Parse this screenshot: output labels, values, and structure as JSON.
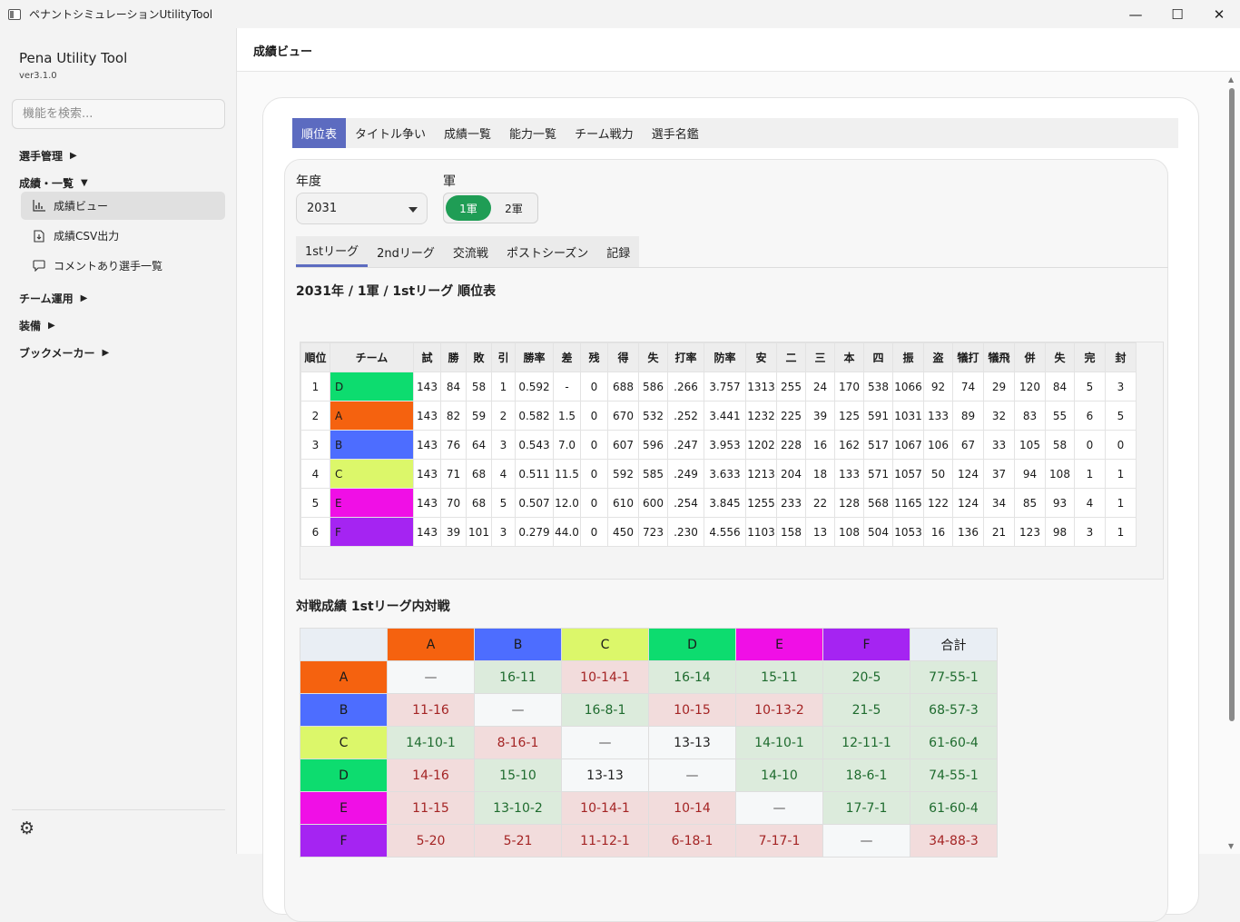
{
  "window": {
    "title": "ペナントシミュレーションUtilityTool",
    "minimize": "—",
    "maximize": "☐",
    "close": "✕"
  },
  "sidebar": {
    "app_name": "Pena Utility Tool",
    "version": "ver3.1.0",
    "search_placeholder": "機能を検索...",
    "groups": [
      {
        "label": "選手管理",
        "arrow": "▶"
      },
      {
        "label": "成績・一覧",
        "arrow": "▼"
      },
      {
        "label": "チーム運用",
        "arrow": "▶"
      },
      {
        "label": "装備",
        "arrow": "▶"
      },
      {
        "label": "ブックメーカー",
        "arrow": "▶"
      }
    ],
    "items": [
      {
        "label": "成績ビュー",
        "icon": "chart-icon"
      },
      {
        "label": "成績CSV出力",
        "icon": "export-icon"
      },
      {
        "label": "コメントあり選手一覧",
        "icon": "comment-icon"
      }
    ]
  },
  "header": {
    "title": "成績ビュー"
  },
  "tabs": [
    "順位表",
    "タイトル争い",
    "成績一覧",
    "能力一覧",
    "チーム戦力",
    "選手名鑑"
  ],
  "filters": {
    "year_label": "年度",
    "year_value": "2031",
    "squad_label": "軍",
    "squad_on": "1軍",
    "squad_off": "2軍"
  },
  "subtabs": [
    "1stリーグ",
    "2ndリーグ",
    "交流戦",
    "ポストシーズン",
    "記録"
  ],
  "standings": {
    "title": "2031年 / 1軍 / 1stリーグ 順位表",
    "headers": [
      "順位",
      "チーム",
      "試",
      "勝",
      "敗",
      "引",
      "勝率",
      "差",
      "残",
      "得",
      "失",
      "打率",
      "防率",
      "安",
      "二",
      "三",
      "本",
      "四",
      "振",
      "盗",
      "犠打",
      "犠飛",
      "併",
      "失",
      "完",
      "封"
    ],
    "rows": [
      [
        "1",
        "D",
        "143",
        "84",
        "58",
        "1",
        "0.592",
        "-",
        "0",
        "688",
        "586",
        ".266",
        "3.757",
        "1313",
        "255",
        "24",
        "170",
        "538",
        "1066",
        "92",
        "74",
        "29",
        "120",
        "84",
        "5",
        "3"
      ],
      [
        "2",
        "A",
        "143",
        "82",
        "59",
        "2",
        "0.582",
        "1.5",
        "0",
        "670",
        "532",
        ".252",
        "3.441",
        "1232",
        "225",
        "39",
        "125",
        "591",
        "1031",
        "133",
        "89",
        "32",
        "83",
        "55",
        "6",
        "5"
      ],
      [
        "3",
        "B",
        "143",
        "76",
        "64",
        "3",
        "0.543",
        "7.0",
        "0",
        "607",
        "596",
        ".247",
        "3.953",
        "1202",
        "228",
        "16",
        "162",
        "517",
        "1067",
        "106",
        "67",
        "33",
        "105",
        "58",
        "0",
        "0"
      ],
      [
        "4",
        "C",
        "143",
        "71",
        "68",
        "4",
        "0.511",
        "11.5",
        "0",
        "592",
        "585",
        ".249",
        "3.633",
        "1213",
        "204",
        "18",
        "133",
        "571",
        "1057",
        "50",
        "124",
        "37",
        "94",
        "108",
        "1",
        "1"
      ],
      [
        "5",
        "E",
        "143",
        "70",
        "68",
        "5",
        "0.507",
        "12.0",
        "0",
        "610",
        "600",
        ".254",
        "3.845",
        "1255",
        "233",
        "22",
        "128",
        "568",
        "1165",
        "122",
        "124",
        "34",
        "85",
        "93",
        "4",
        "1"
      ],
      [
        "6",
        "F",
        "143",
        "39",
        "101",
        "3",
        "0.279",
        "44.0",
        "0",
        "450",
        "723",
        ".230",
        "4.556",
        "1103",
        "158",
        "13",
        "108",
        "504",
        "1053",
        "16",
        "136",
        "21",
        "123",
        "98",
        "3",
        "1"
      ]
    ]
  },
  "team_colors": {
    "A": "#f5620f",
    "B": "#4d6dff",
    "C": "#dcf76a",
    "D": "#0ddc6f",
    "E": "#f00fe6",
    "F": "#a524f2"
  },
  "vs": {
    "title": "対戦成績 1stリーグ内対戦",
    "columns": [
      "A",
      "B",
      "C",
      "D",
      "E",
      "F"
    ],
    "total_label": "合計",
    "rows": [
      {
        "team": "A",
        "cells": [
          "—",
          "16-11",
          "10-14-1",
          "16-14",
          "15-11",
          "20-5"
        ],
        "total": "77-55-1"
      },
      {
        "team": "B",
        "cells": [
          "11-16",
          "—",
          "16-8-1",
          "10-15",
          "10-13-2",
          "21-5"
        ],
        "total": "68-57-3"
      },
      {
        "team": "C",
        "cells": [
          "14-10-1",
          "8-16-1",
          "—",
          "13-13",
          "14-10-1",
          "12-11-1"
        ],
        "total": "61-60-4"
      },
      {
        "team": "D",
        "cells": [
          "14-16",
          "15-10",
          "13-13",
          "—",
          "14-10",
          "18-6-1"
        ],
        "total": "74-55-1"
      },
      {
        "team": "E",
        "cells": [
          "11-15",
          "13-10-2",
          "10-14-1",
          "10-14",
          "—",
          "17-7-1"
        ],
        "total": "61-60-4"
      },
      {
        "team": "F",
        "cells": [
          "5-20",
          "5-21",
          "11-12-1",
          "6-18-1",
          "7-17-1",
          "—"
        ],
        "total": "34-88-3"
      }
    ]
  }
}
